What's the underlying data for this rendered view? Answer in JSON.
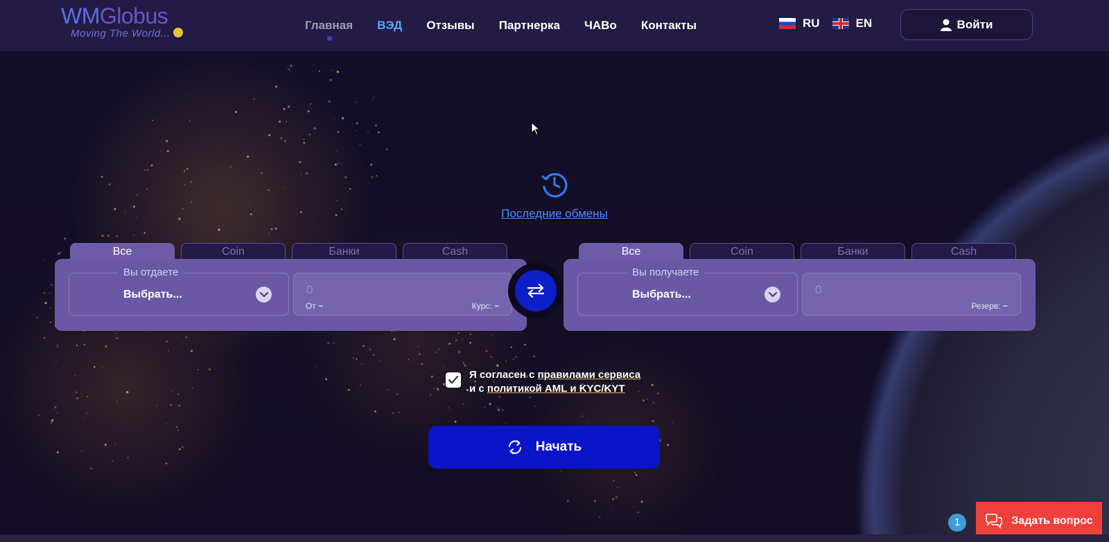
{
  "logo": {
    "brand_a": "WM",
    "brand_b": "Globus",
    "tagline": "Moving The World..."
  },
  "nav": [
    {
      "label": "Главная",
      "active": true
    },
    {
      "label": "ВЭД"
    },
    {
      "label": "Отзывы"
    },
    {
      "label": "Партнерка"
    },
    {
      "label": "ЧАВо"
    },
    {
      "label": "Контакты"
    }
  ],
  "langs": [
    {
      "code": "RU",
      "icon": "flag-ru-icon"
    },
    {
      "code": "EN",
      "icon": "flag-uk-icon"
    }
  ],
  "login": {
    "label": "Войти",
    "icon": "user-icon"
  },
  "recent": {
    "label": "Последние обмены",
    "icon": "history-icon"
  },
  "give": {
    "tabs": [
      "Все",
      "Coin",
      "Банки",
      "Cash"
    ],
    "selected_tab": "Все",
    "legend": "Вы отдаете",
    "select_value": "Выбрать...",
    "amount": "0",
    "from_label": "От",
    "from_value": "~",
    "rate_label": "Курс:",
    "rate_value": "~"
  },
  "receive": {
    "tabs": [
      "Все",
      "Coin",
      "Банки",
      "Cash"
    ],
    "selected_tab": "Все",
    "legend": "Вы получаете",
    "select_value": "Выбрать...",
    "amount": "0",
    "reserve_label": "Резерв:",
    "reserve_value": "~"
  },
  "agree": {
    "checked": true,
    "line1_prefix": "Я согласен с ",
    "rules_link": "правилами сервиса",
    "line2_prefix": "и с ",
    "policy_link": "политикой AML и KYC/KYT"
  },
  "start": {
    "label": "Начать",
    "icon": "refresh-icon"
  },
  "chat": {
    "badge": "1",
    "label": "Задать вопрос",
    "icon": "chat-icon"
  },
  "colors": {
    "header": "#241b44",
    "panel": "#6b58a5",
    "primary": "#0a14c9",
    "ask": "#f0403c",
    "link": "#4c8bff"
  }
}
